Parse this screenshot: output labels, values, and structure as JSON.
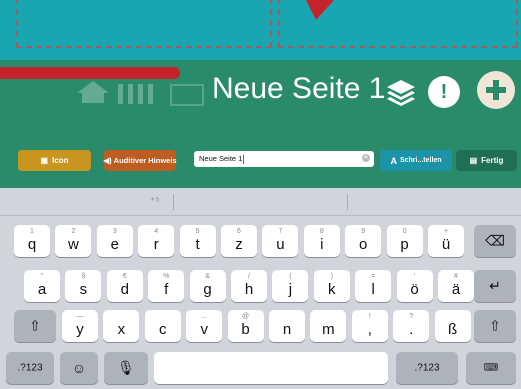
{
  "header": {
    "page_title": "Neue Seite 1"
  },
  "toolbar": {
    "icon_label": "Icon",
    "audio_label": "Auditiver Hinweis",
    "text_value": "Neue Seite 1",
    "write_label": "Schri...tellen",
    "done_label": "Fertig"
  },
  "keyboard": {
    "row1": [
      {
        "main": "q",
        "alt": "1"
      },
      {
        "main": "w",
        "alt": "2"
      },
      {
        "main": "e",
        "alt": "3"
      },
      {
        "main": "r",
        "alt": "4"
      },
      {
        "main": "t",
        "alt": "5"
      },
      {
        "main": "z",
        "alt": "6"
      },
      {
        "main": "u",
        "alt": "7"
      },
      {
        "main": "i",
        "alt": "8"
      },
      {
        "main": "o",
        "alt": "9"
      },
      {
        "main": "p",
        "alt": "0"
      },
      {
        "main": "ü",
        "alt": "+"
      }
    ],
    "row2": [
      {
        "main": "a",
        "alt": "\""
      },
      {
        "main": "s",
        "alt": "§"
      },
      {
        "main": "d",
        "alt": "€"
      },
      {
        "main": "f",
        "alt": "%"
      },
      {
        "main": "g",
        "alt": "&"
      },
      {
        "main": "h",
        "alt": "/"
      },
      {
        "main": "j",
        "alt": "("
      },
      {
        "main": "k",
        "alt": ")"
      },
      {
        "main": "l",
        "alt": "="
      },
      {
        "main": "ö",
        "alt": "'"
      },
      {
        "main": "ä",
        "alt": "#"
      }
    ],
    "row3": [
      {
        "main": "y",
        "alt": "—"
      },
      {
        "main": "x",
        "alt": ""
      },
      {
        "main": "c",
        "alt": ""
      },
      {
        "main": "v",
        "alt": "..."
      },
      {
        "main": "b",
        "alt": "@"
      },
      {
        "main": "n",
        "alt": ""
      },
      {
        "main": "m",
        "alt": ""
      },
      {
        "main": ",",
        "alt": "!"
      },
      {
        "main": ".",
        "alt": "?"
      },
      {
        "main": "ß",
        "alt": ""
      }
    ],
    "numbers_label": ".?123",
    "numbers_label_right": ".?123"
  },
  "colors": {
    "top_teal": "#1aa6b1",
    "header_green": "#2a8b6a",
    "icon_button": "#c8961f",
    "audio_button": "#bd5d21",
    "write_button": "#1c94a8",
    "done_button": "#1f6e55",
    "annotation_red": "#c4232b"
  }
}
